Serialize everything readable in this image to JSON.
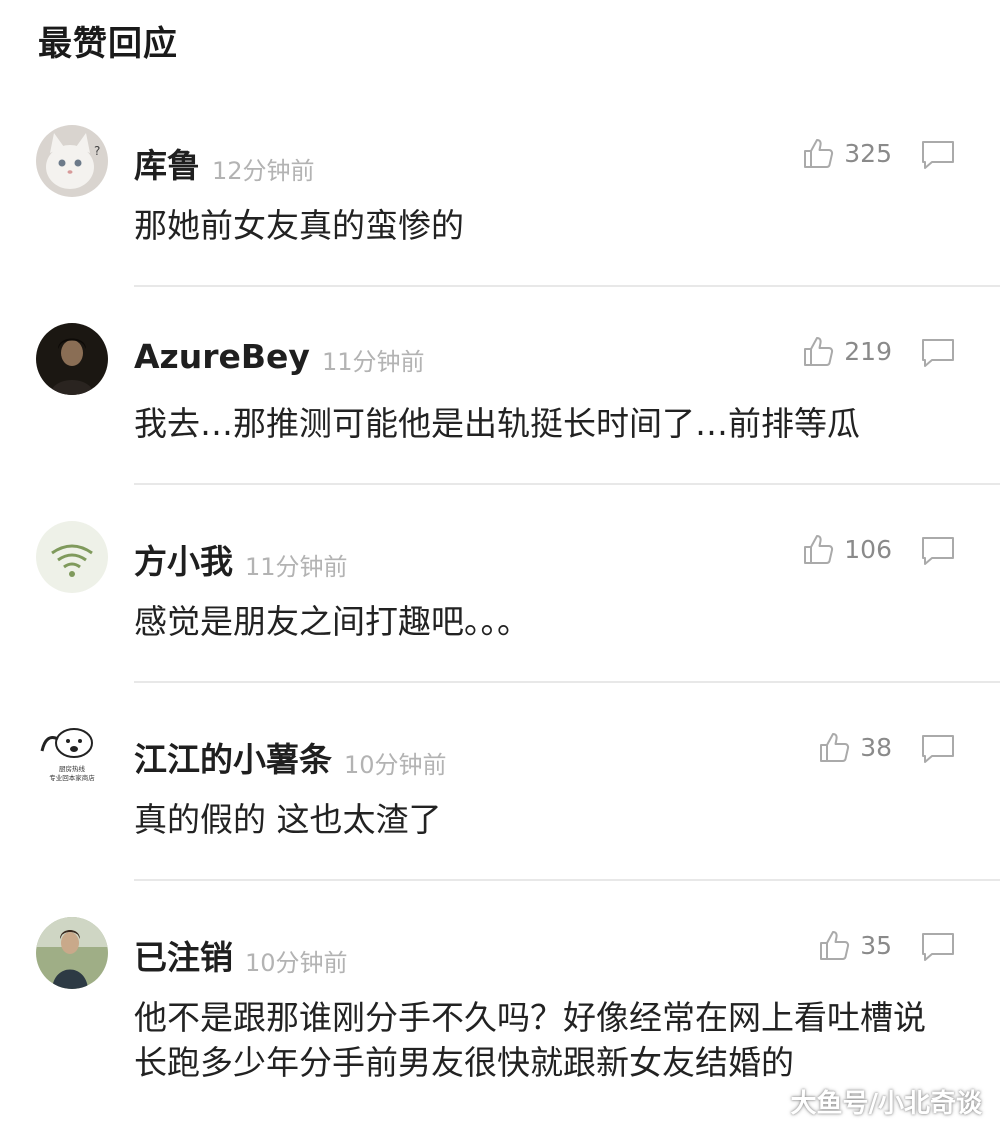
{
  "section_title": "最赞回应",
  "comments": [
    {
      "username": "库鲁",
      "time": "12分钟前",
      "likes": "325",
      "text": "那她前女友真的蛮惨的",
      "avatar": "white-cat-avatar"
    },
    {
      "username": "AzureBey",
      "time": "11分钟前",
      "likes": "219",
      "text": "我去…那推测可能他是出轨挺长时间了…前排等瓜",
      "avatar": "dark-portrait-avatar"
    },
    {
      "username": "方小我",
      "time": "11分钟前",
      "likes": "106",
      "text": "感觉是朋友之间打趣吧。。。",
      "avatar": "wifi-avatar"
    },
    {
      "username": "江江的小薯条",
      "time": "10分钟前",
      "likes": "38",
      "text": "真的假的 这也太渣了",
      "avatar": "cartoon-sticker-avatar",
      "avatar_caption": "厨房热线 专业回本家商店"
    },
    {
      "username": "已注销",
      "time": "10分钟前",
      "likes": "35",
      "text": "他不是跟那谁刚分手不久吗？好像经常在网上看吐槽说长跑多少年分手前男友很快就跟新女友结婚的",
      "avatar": "outdoor-person-avatar"
    }
  ],
  "watermark": "大鱼号/小北奇谈",
  "colors": {
    "text": "#222222",
    "time": "#b3b3b3",
    "count": "#8a8a8a",
    "icon": "#aaaaaa",
    "divider": "#e8e8e8"
  }
}
